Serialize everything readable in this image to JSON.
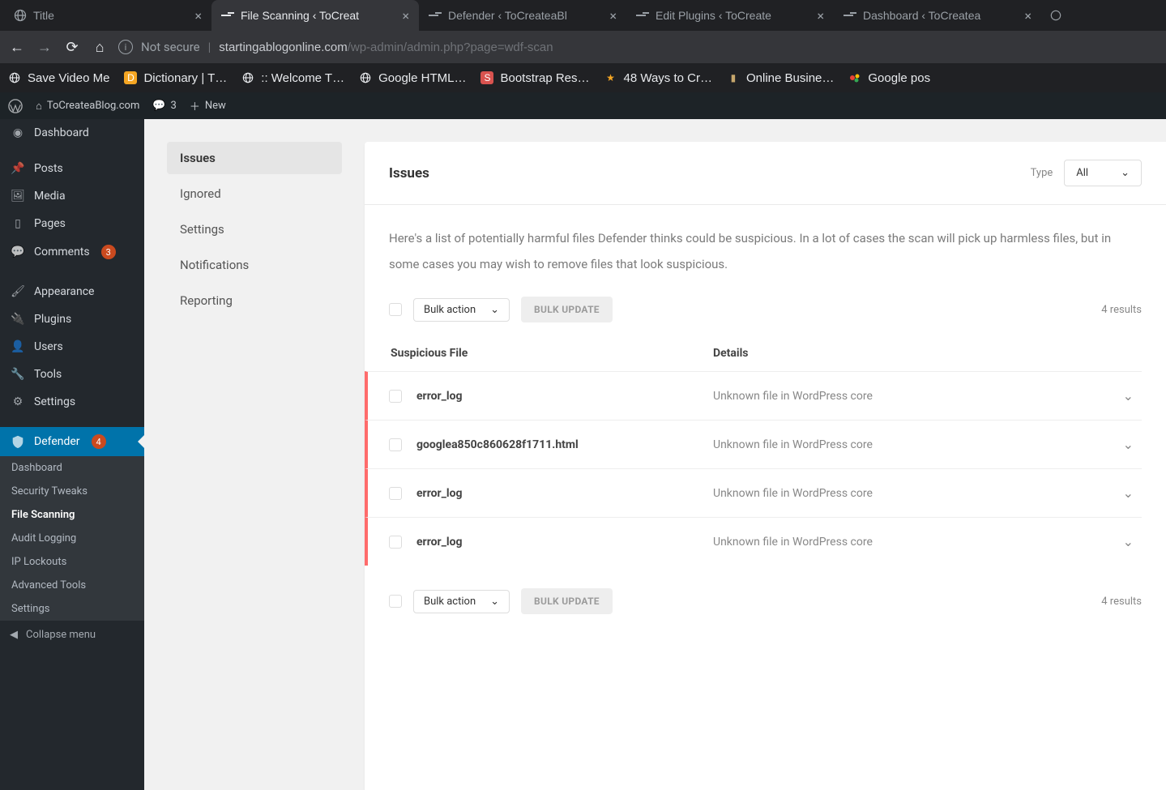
{
  "browser": {
    "tabs": [
      {
        "label": "Title"
      },
      {
        "label": "File Scanning ‹ ToCreat"
      },
      {
        "label": "Defender ‹ ToCreateaBl"
      },
      {
        "label": "Edit Plugins ‹ ToCreate"
      },
      {
        "label": "Dashboard ‹ ToCreatea"
      }
    ],
    "not_secure": "Not secure",
    "url_host": "startingablogonline.com",
    "url_path": "/wp-admin/admin.php?page=wdf-scan",
    "bookmarks": [
      {
        "label": "Save Video Me"
      },
      {
        "label": "Dictionary | T…"
      },
      {
        "label": ":: Welcome T…"
      },
      {
        "label": "Google HTML…"
      },
      {
        "label": "Bootstrap Res…"
      },
      {
        "label": "48 Ways to Cr…"
      },
      {
        "label": "Online Busine…"
      },
      {
        "label": "Google pos"
      }
    ]
  },
  "adminbar": {
    "site": "ToCreateaBlog.com",
    "comments": "3",
    "new": "New"
  },
  "menu": {
    "dashboard": "Dashboard",
    "posts": "Posts",
    "media": "Media",
    "pages": "Pages",
    "comments": "Comments",
    "comments_badge": "3",
    "appearance": "Appearance",
    "plugins": "Plugins",
    "users": "Users",
    "tools": "Tools",
    "settings": "Settings",
    "defender": "Defender",
    "defender_badge": "4",
    "sub": {
      "dashboard": "Dashboard",
      "tweaks": "Security Tweaks",
      "file": "File Scanning",
      "audit": "Audit Logging",
      "lockouts": "IP Lockouts",
      "advanced": "Advanced Tools",
      "settings": "Settings"
    },
    "collapse": "Collapse menu"
  },
  "localTabs": {
    "issues": "Issues",
    "ignored": "Ignored",
    "settings": "Settings",
    "notifications": "Notifications",
    "reporting": "Reporting"
  },
  "panel": {
    "title": "Issues",
    "type_label": "Type",
    "type_value": "All",
    "desc": "Here's a list of potentially harmful files Defender thinks could be suspicious. In a lot of cases the scan will pick up harmless files, but in some cases you may wish to  remove files that look suspicious.",
    "bulk_action": "Bulk action",
    "bulk_update": "BULK UPDATE",
    "results": "4 results",
    "col_file": "Suspicious File",
    "col_details": "Details",
    "rows": [
      {
        "file": "error_log",
        "details": "Unknown file in WordPress core"
      },
      {
        "file": "googlea850c860628f1711.html",
        "details": "Unknown file in WordPress core"
      },
      {
        "file": "error_log",
        "details": "Unknown file in WordPress core"
      },
      {
        "file": "error_log",
        "details": "Unknown file in WordPress core"
      }
    ]
  }
}
